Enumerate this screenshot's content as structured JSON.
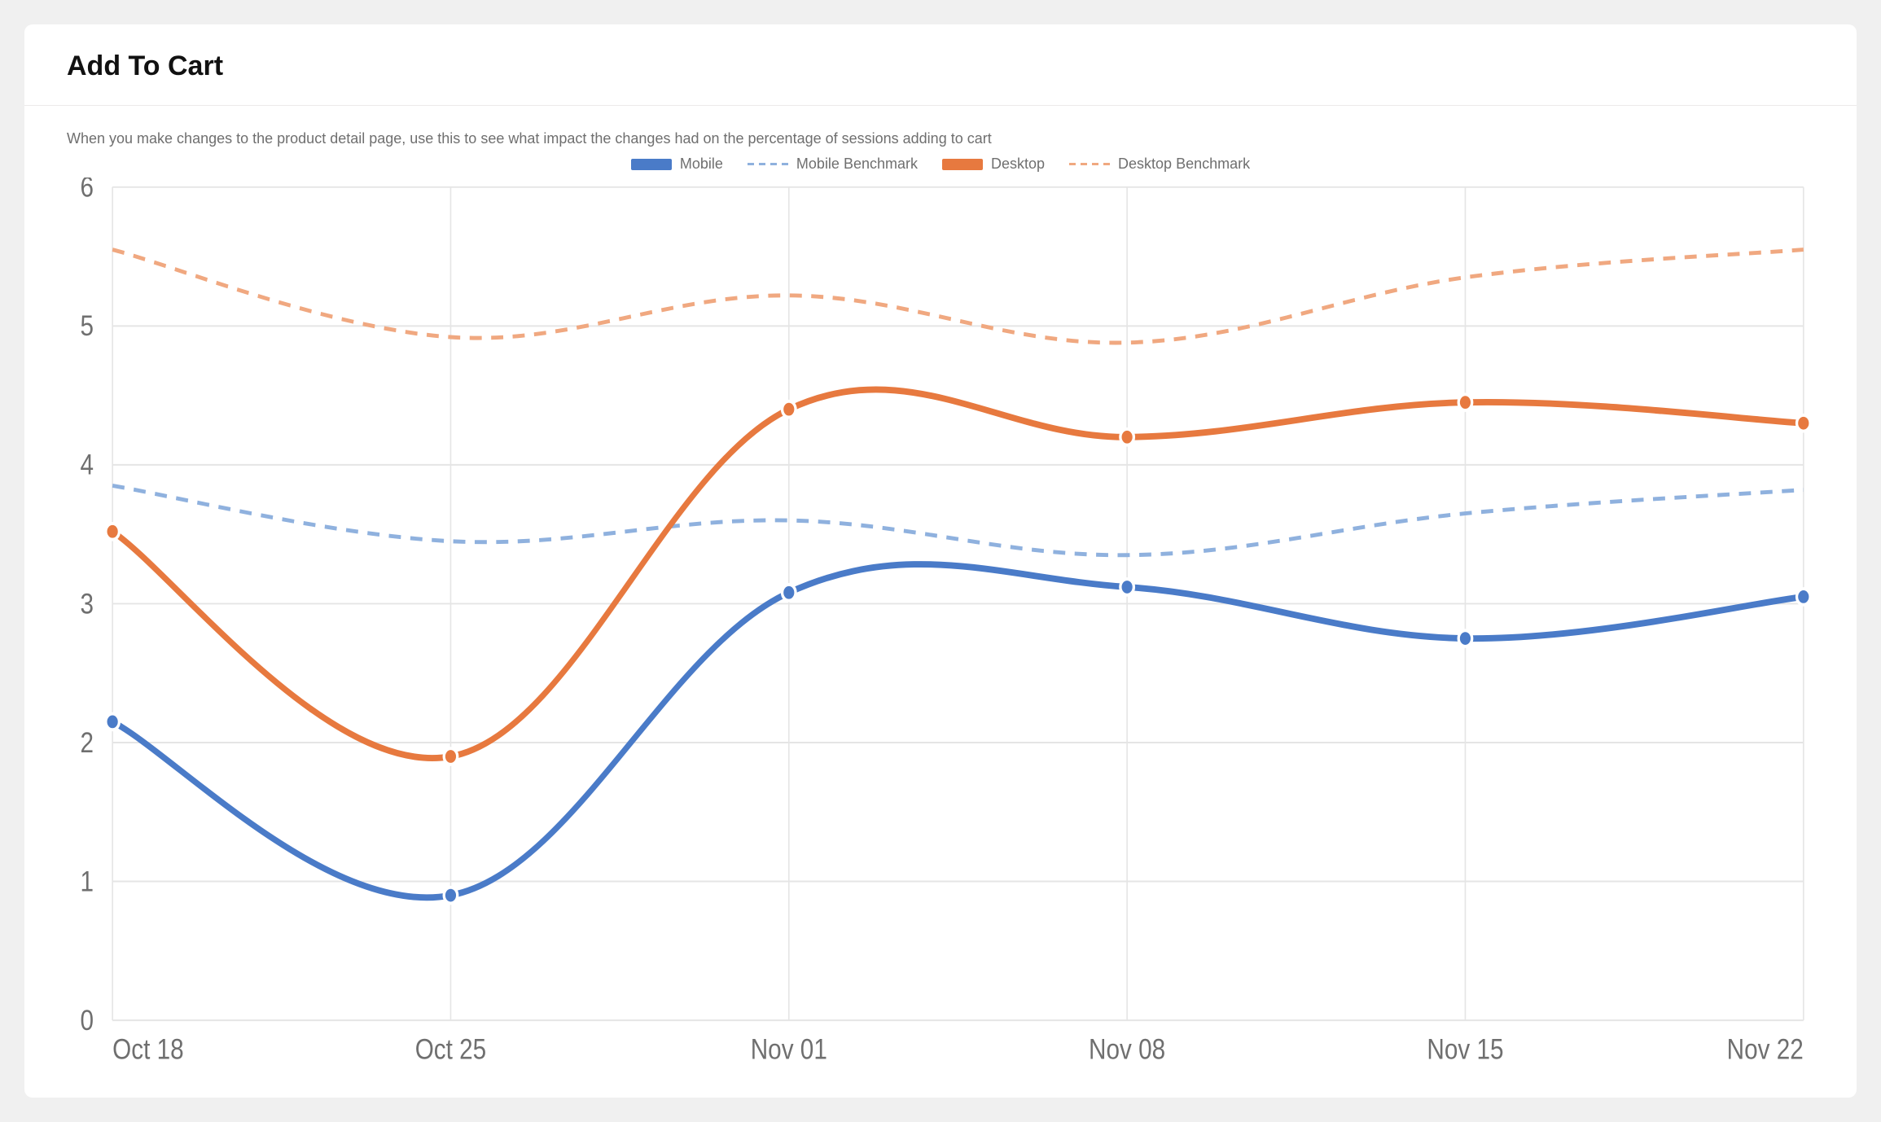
{
  "card": {
    "title": "Add To Cart",
    "description": "When you make changes to the product detail page, use this to see what impact the changes had on the percentage of sessions adding to cart"
  },
  "legend": {
    "mobile": "Mobile",
    "mobile_benchmark": "Mobile Benchmark",
    "desktop": "Desktop",
    "desktop_benchmark": "Desktop Benchmark"
  },
  "colors": {
    "mobile": "#4a7bc8",
    "mobile_benchmark": "#8fb1de",
    "desktop": "#e7793f",
    "desktop_benchmark": "#f0a880"
  },
  "chart_data": {
    "type": "line",
    "title": "Add To Cart",
    "xlabel": "",
    "ylabel": "",
    "ylim": [
      0,
      6
    ],
    "y_ticks": [
      0,
      1,
      2,
      3,
      4,
      5,
      6
    ],
    "categories": [
      "Oct 18",
      "Oct 25",
      "Nov 01",
      "Nov 08",
      "Nov 15",
      "Nov 22"
    ],
    "series": [
      {
        "name": "Mobile",
        "style": "solid",
        "color": "#4a7bc8",
        "values": [
          2.15,
          0.9,
          3.08,
          3.12,
          2.75,
          3.05
        ]
      },
      {
        "name": "Mobile Benchmark",
        "style": "dashed",
        "color": "#8fb1de",
        "values": [
          3.85,
          3.45,
          3.6,
          3.35,
          3.65,
          3.82
        ]
      },
      {
        "name": "Desktop",
        "style": "solid",
        "color": "#e7793f",
        "values": [
          3.52,
          1.9,
          4.4,
          4.2,
          4.45,
          4.3
        ]
      },
      {
        "name": "Desktop Benchmark",
        "style": "dashed",
        "color": "#f0a880",
        "values": [
          5.55,
          4.92,
          5.22,
          4.88,
          5.35,
          5.55
        ]
      }
    ]
  }
}
